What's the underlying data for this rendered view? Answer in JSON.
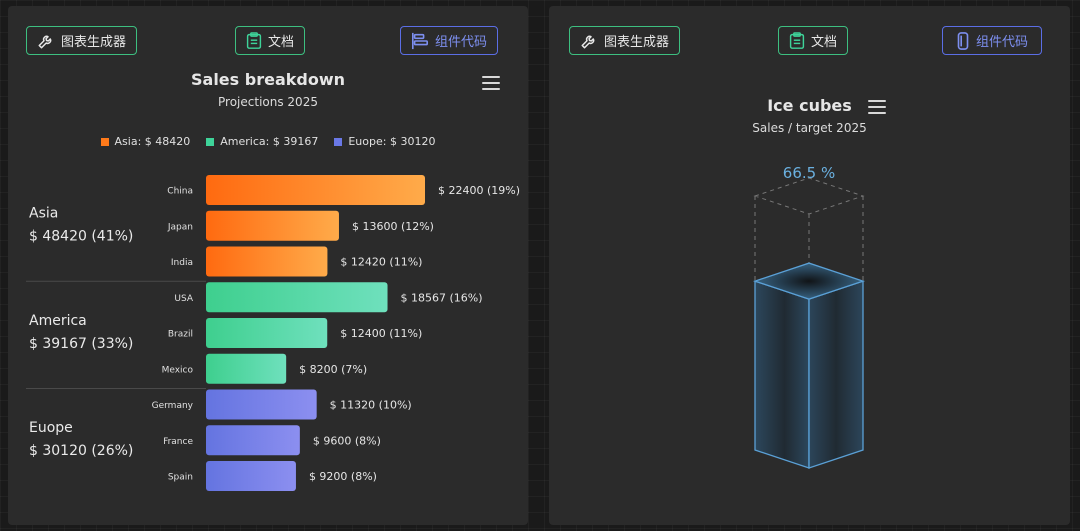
{
  "toolbar": {
    "chart_generator": "图表生成器",
    "docs": "文档",
    "component_code": "组件代码"
  },
  "left": {
    "title": "Sales breakdown",
    "subtitle": "Projections 2025"
  },
  "right": {
    "title": "Ice cubes",
    "subtitle": "Sales / target 2025"
  },
  "colors": {
    "orange": "#ff7a1a",
    "green": "#3ed399",
    "blue": "#6a78e6",
    "cube_edge": "#5aa0d6",
    "percent_text": "#6ab0e0"
  },
  "chart_data": [
    {
      "type": "bar",
      "title": "Sales breakdown",
      "subtitle": "Projections 2025",
      "legend": [
        {
          "label": "Asia: $ 48420",
          "color": "#ff7a1a"
        },
        {
          "label": "America: $ 39167",
          "color": "#3ed399"
        },
        {
          "label": "Euope: $ 30120",
          "color": "#6a78e6"
        }
      ],
      "groups": [
        {
          "name": "Asia",
          "total_label": "$ 48420 (41%)",
          "color_from": "#ff6a10",
          "color_to": "#ffab4a",
          "items": [
            {
              "category": "China",
              "value": 22400,
              "label": "$ 22400 (19%)"
            },
            {
              "category": "Japan",
              "value": 13600,
              "label": "$ 13600 (12%)"
            },
            {
              "category": "India",
              "value": 12420,
              "label": "$ 12420 (11%)"
            }
          ]
        },
        {
          "name": "America",
          "total_label": "$ 39167 (33%)",
          "color_from": "#3ecf8e",
          "color_to": "#6fe0bd",
          "items": [
            {
              "category": "USA",
              "value": 18567,
              "label": "$ 18567 (16%)"
            },
            {
              "category": "Brazil",
              "value": 12400,
              "label": "$ 12400 (11%)"
            },
            {
              "category": "Mexico",
              "value": 8200,
              "label": "$ 8200 (7%)"
            }
          ]
        },
        {
          "name": "Euope",
          "total_label": "$ 30120 (26%)",
          "color_from": "#6474e0",
          "color_to": "#8c8ff0",
          "items": [
            {
              "category": "Germany",
              "value": 11320,
              "label": "$ 11320 (10%)"
            },
            {
              "category": "France",
              "value": 9600,
              "label": "$ 9600 (8%)"
            },
            {
              "category": "Spain",
              "value": 9200,
              "label": "$ 9200 (8%)"
            }
          ]
        }
      ]
    },
    {
      "type": "gauge",
      "title": "Ice cubes",
      "subtitle": "Sales / target 2025",
      "value_percent": 66.5,
      "value_label": "66.5 %"
    }
  ]
}
